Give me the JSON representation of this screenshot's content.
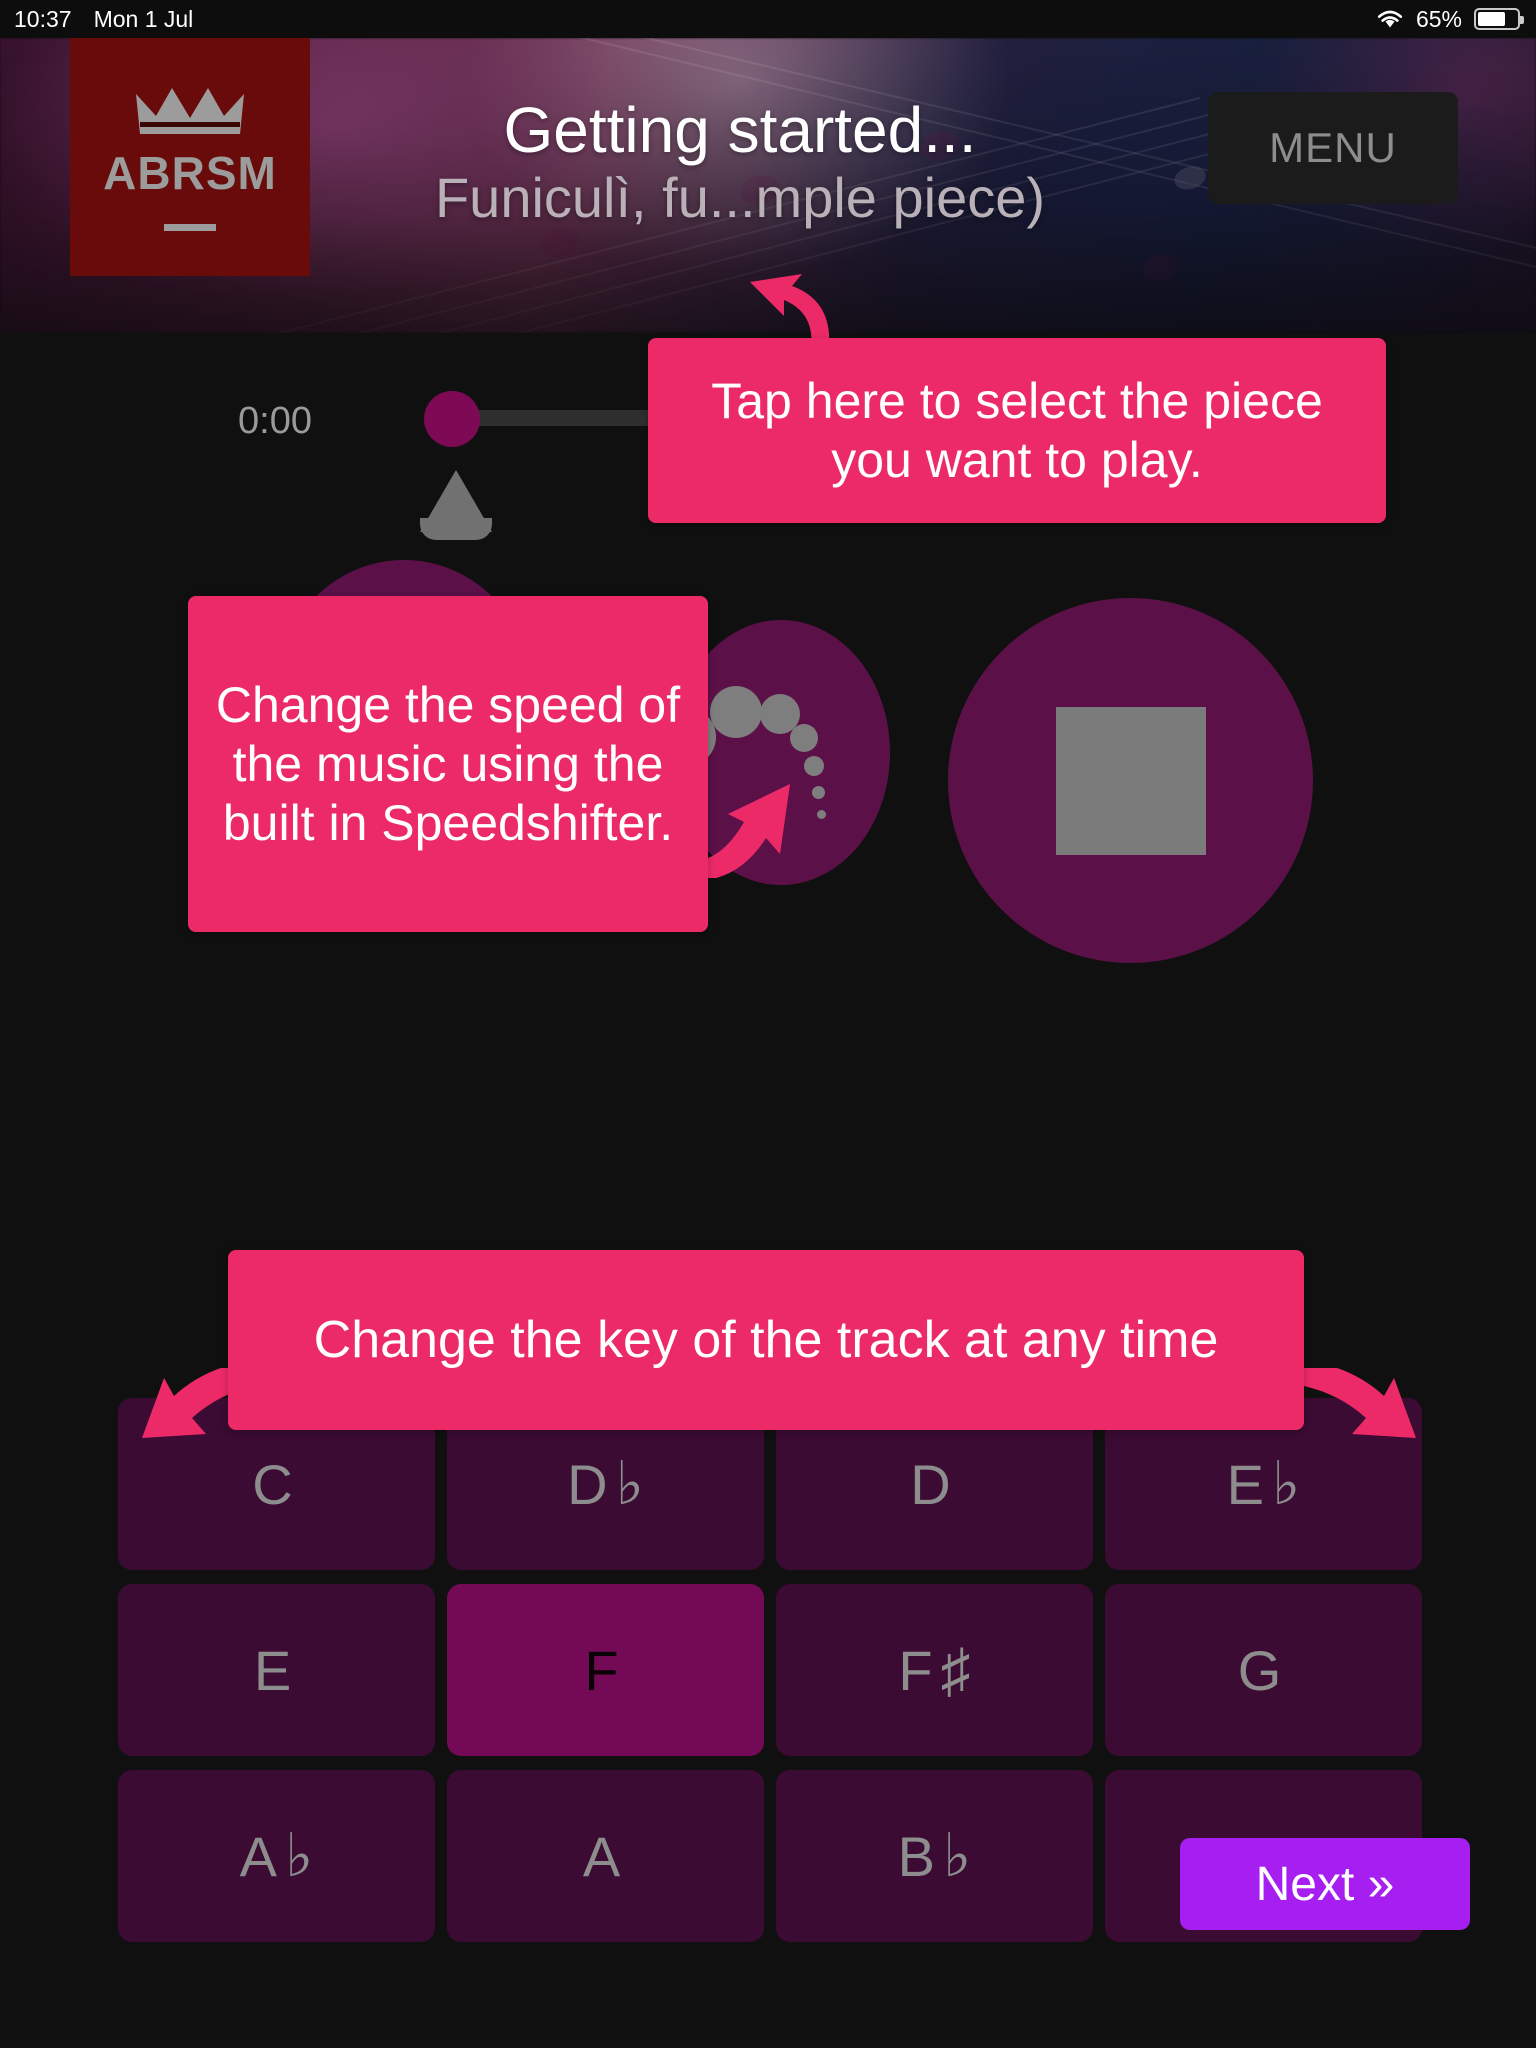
{
  "status_bar": {
    "time": "10:37",
    "date": "Mon 1 Jul",
    "battery_percent": "65%",
    "wifi_icon": "wifi-icon",
    "battery_icon": "battery-icon",
    "battery_level": 65
  },
  "header": {
    "logo_text": "ABRSM",
    "logo_icon": "crown-icon",
    "title": "Getting started...",
    "subtitle": "Funiculì, fu...mple piece)",
    "menu_label": "MENU"
  },
  "player": {
    "current_time": "0:00",
    "seek_position_percent": 0,
    "metronome_icon": "metronome-cone-icon",
    "speedshifter_icon": "speedshifter-dots-icon",
    "stop_icon": "stop-square-icon",
    "loop_icon": "loop-circle-icon"
  },
  "tooltips": [
    {
      "id": "tooltip-select-piece",
      "text": "Tap here to select the piece you want to play."
    },
    {
      "id": "tooltip-speedshifter",
      "text": "Change the speed of the music using the built in Speedshifter."
    },
    {
      "id": "tooltip-change-key",
      "text": "Change the key of the track at any time"
    }
  ],
  "keys": {
    "selected": "F",
    "items": [
      {
        "note": "C",
        "accidental": ""
      },
      {
        "note": "D",
        "accidental": "♭"
      },
      {
        "note": "D",
        "accidental": ""
      },
      {
        "note": "E",
        "accidental": "♭"
      },
      {
        "note": "E",
        "accidental": ""
      },
      {
        "note": "F",
        "accidental": ""
      },
      {
        "note": "F",
        "accidental": "♯"
      },
      {
        "note": "G",
        "accidental": ""
      },
      {
        "note": "A",
        "accidental": "♭"
      },
      {
        "note": "A",
        "accidental": ""
      },
      {
        "note": "B",
        "accidental": "♭"
      },
      {
        "note": "",
        "accidental": ""
      }
    ]
  },
  "next_button": {
    "label": "Next »"
  },
  "colors": {
    "tooltip_pink": "#ED2A68",
    "key_default": "#3B0B33",
    "key_selected": "#740A55",
    "next_purple": "#A61FF0",
    "logo_red": "#6A0B0B",
    "control_purple": "#5C1048",
    "background": "#111010"
  }
}
